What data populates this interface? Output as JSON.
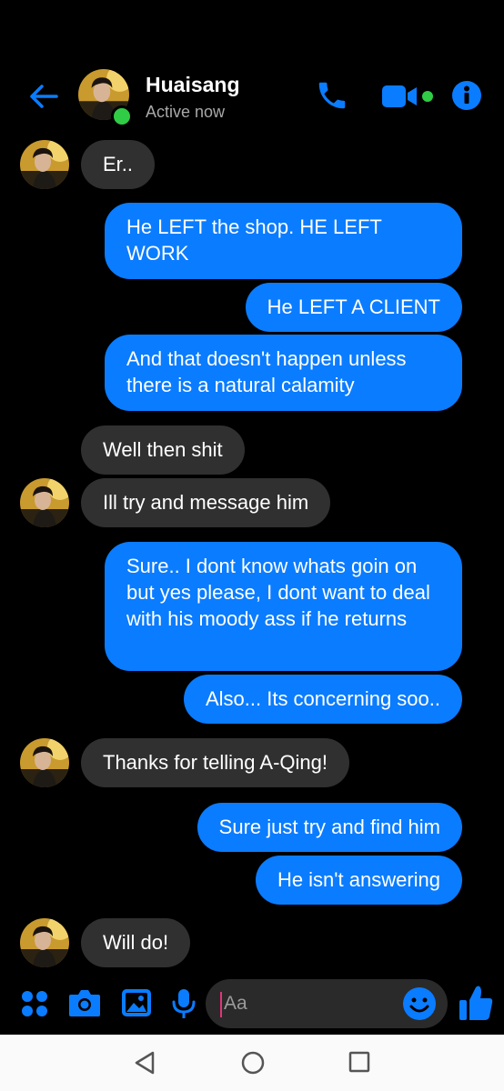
{
  "header": {
    "name": "Huaisang",
    "status": "Active now"
  },
  "messages": {
    "m1": "Er..",
    "m2": "He LEFT the shop. HE LEFT WORK",
    "m3": "He LEFT A CLIENT",
    "m4": "And that doesn't happen unless there is a natural calamity",
    "m5": "Well then shit",
    "m6": "Ill try and message him",
    "m7": "Sure.. I dont know whats goin on but yes please, I dont want to deal with his moody ass if he returns",
    "m8": "Also... Its concerning soo..",
    "m9": "Thanks for telling A-Qing!",
    "m10": "Sure just try and find him",
    "m11": "He isn't answering",
    "m12": "Will do!"
  },
  "composer": {
    "placeholder": "Aa"
  },
  "colors": {
    "accent": "#0a7cff",
    "incoming_bubble": "#303030",
    "online": "#31cc46"
  },
  "icons": [
    "back-arrow-icon",
    "phone-icon",
    "video-camera-icon",
    "info-icon",
    "apps-icon",
    "camera-icon",
    "gallery-icon",
    "microphone-icon",
    "emoji-icon",
    "thumbs-up-icon",
    "nav-back-icon",
    "nav-home-icon",
    "nav-recents-icon"
  ]
}
